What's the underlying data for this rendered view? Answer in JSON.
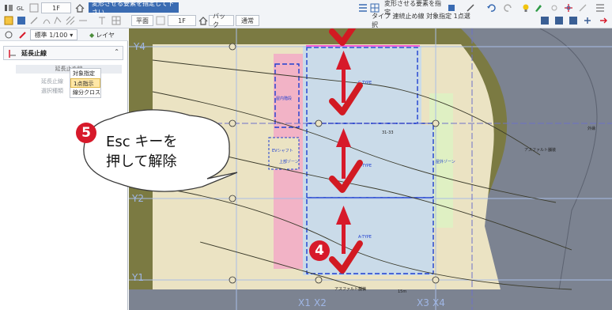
{
  "ribbon": {
    "row1": {
      "level_label": "1F",
      "prompt_message": "変形させる要素を指定して下さい。",
      "select_label": "変形させる要素を指定"
    },
    "row2": {
      "scale_value": "標準 1/100",
      "layer_label": "レイヤ",
      "view_plan": "平面",
      "view_level": "1F",
      "view_back": "バック",
      "view_normal": "通常",
      "status_text": "タイプ  連続止め線  対象指定  1点選択"
    }
  },
  "left_panel": {
    "title": "延長止線",
    "group_title": "延長止め線",
    "prop1_label": "延長止線",
    "prop2_label": "選択種類",
    "dropdown_options": [
      "対象指定",
      "1点指示",
      "線分クロス"
    ],
    "dropdown_selected": "1点指示"
  },
  "canvas": {
    "grid_labels_y": [
      "Y4",
      "Y2",
      "Y1"
    ],
    "grid_labels_x": [
      "X1",
      "X2",
      "X3",
      "X4"
    ],
    "room_labels": [
      "C-TYPE",
      "B-TYPE",
      "A-TYPE",
      "EVシャフト",
      "上部ゾーン",
      "屋内階段",
      "屋外ゾーン"
    ],
    "road_labels": [
      "アスファルト舗装",
      "アスファルト舗装"
    ],
    "small_labels": [
      "31-33",
      "15m",
      "外縁"
    ]
  },
  "callouts": {
    "main_line1": "Esc キーを",
    "main_line2": "押して解除",
    "badge5": "5",
    "badge4": "4"
  },
  "colors": {
    "ground": "#7b7a42",
    "site": "#ebe3c3",
    "building_blue": "#cadbe9",
    "pink": "#f2b3c6",
    "green": "#dff0c3",
    "road": "#7c8391",
    "arrow_red": "#d7192a",
    "check_red": "#d21a22",
    "dash_blue": "#1e3fd0"
  }
}
